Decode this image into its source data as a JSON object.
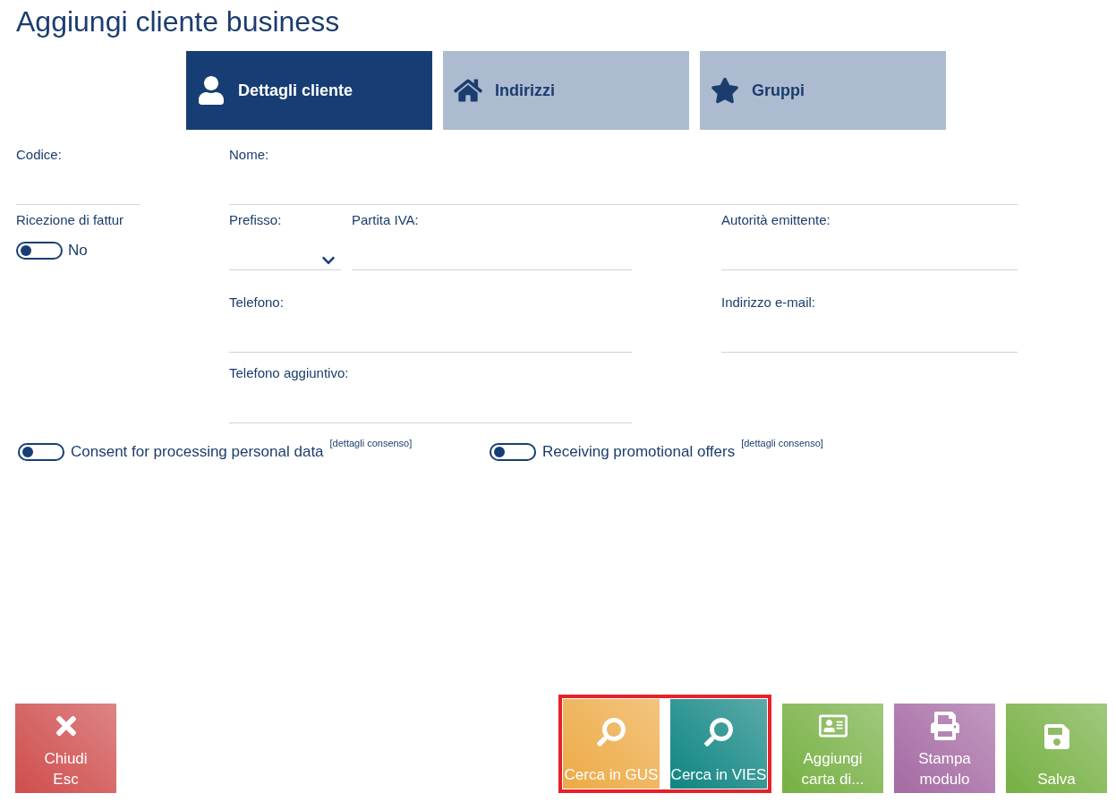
{
  "title": "Aggiungi cliente business",
  "tabs": [
    {
      "label": "Dettagli cliente",
      "kind": "user",
      "selected": true
    },
    {
      "label": "Indirizzi",
      "kind": "home",
      "selected": false
    },
    {
      "label": "Gruppi",
      "kind": "star",
      "selected": false
    }
  ],
  "fields": [
    {
      "kind": "text",
      "label": "Codice:"
    },
    {
      "kind": "text",
      "label": "Nome:"
    },
    {
      "kind": "toggle",
      "label": "Ricezione di fattur",
      "on": false,
      "value": "No"
    },
    {
      "kind": "select",
      "label": "Prefisso:"
    },
    {
      "kind": "text",
      "label": "Partita IVA:"
    },
    {
      "kind": "text",
      "label": "Autorità emittente:"
    },
    {
      "kind": "text",
      "label": "Telefono:"
    },
    {
      "kind": "text",
      "label": "Indirizzo e-mail:"
    },
    {
      "kind": "text",
      "label": "Telefono aggiuntivo:"
    }
  ],
  "consents": [
    {
      "label": "Consent for processing personal data",
      "on": false,
      "details": "[dettagli consenso]"
    },
    {
      "label": "Receiving promotional offers",
      "on": false,
      "details": "[dettagli consenso]"
    }
  ],
  "buttons": [
    {
      "kind": "close",
      "lines": [
        "Chiudi",
        "Esc"
      ],
      "color": "#cf4d4d",
      "highlighted": false
    },
    {
      "kind": "search",
      "lines": [
        "Cerca in GUS"
      ],
      "color": "#edaa45",
      "highlighted": true
    },
    {
      "kind": "search",
      "lines": [
        "Cerca in VIES"
      ],
      "color": "#0f8582",
      "highlighted": true
    },
    {
      "kind": "card",
      "lines": [
        "Aggiungi",
        "carta di..."
      ],
      "color": "#76b043",
      "highlighted": false
    },
    {
      "kind": "print",
      "lines": [
        "Stampa",
        "modulo"
      ],
      "color": "#a56aa3",
      "highlighted": false
    },
    {
      "kind": "save",
      "lines": [
        "Salva"
      ],
      "color": "#76b043",
      "highlighted": false
    }
  ]
}
